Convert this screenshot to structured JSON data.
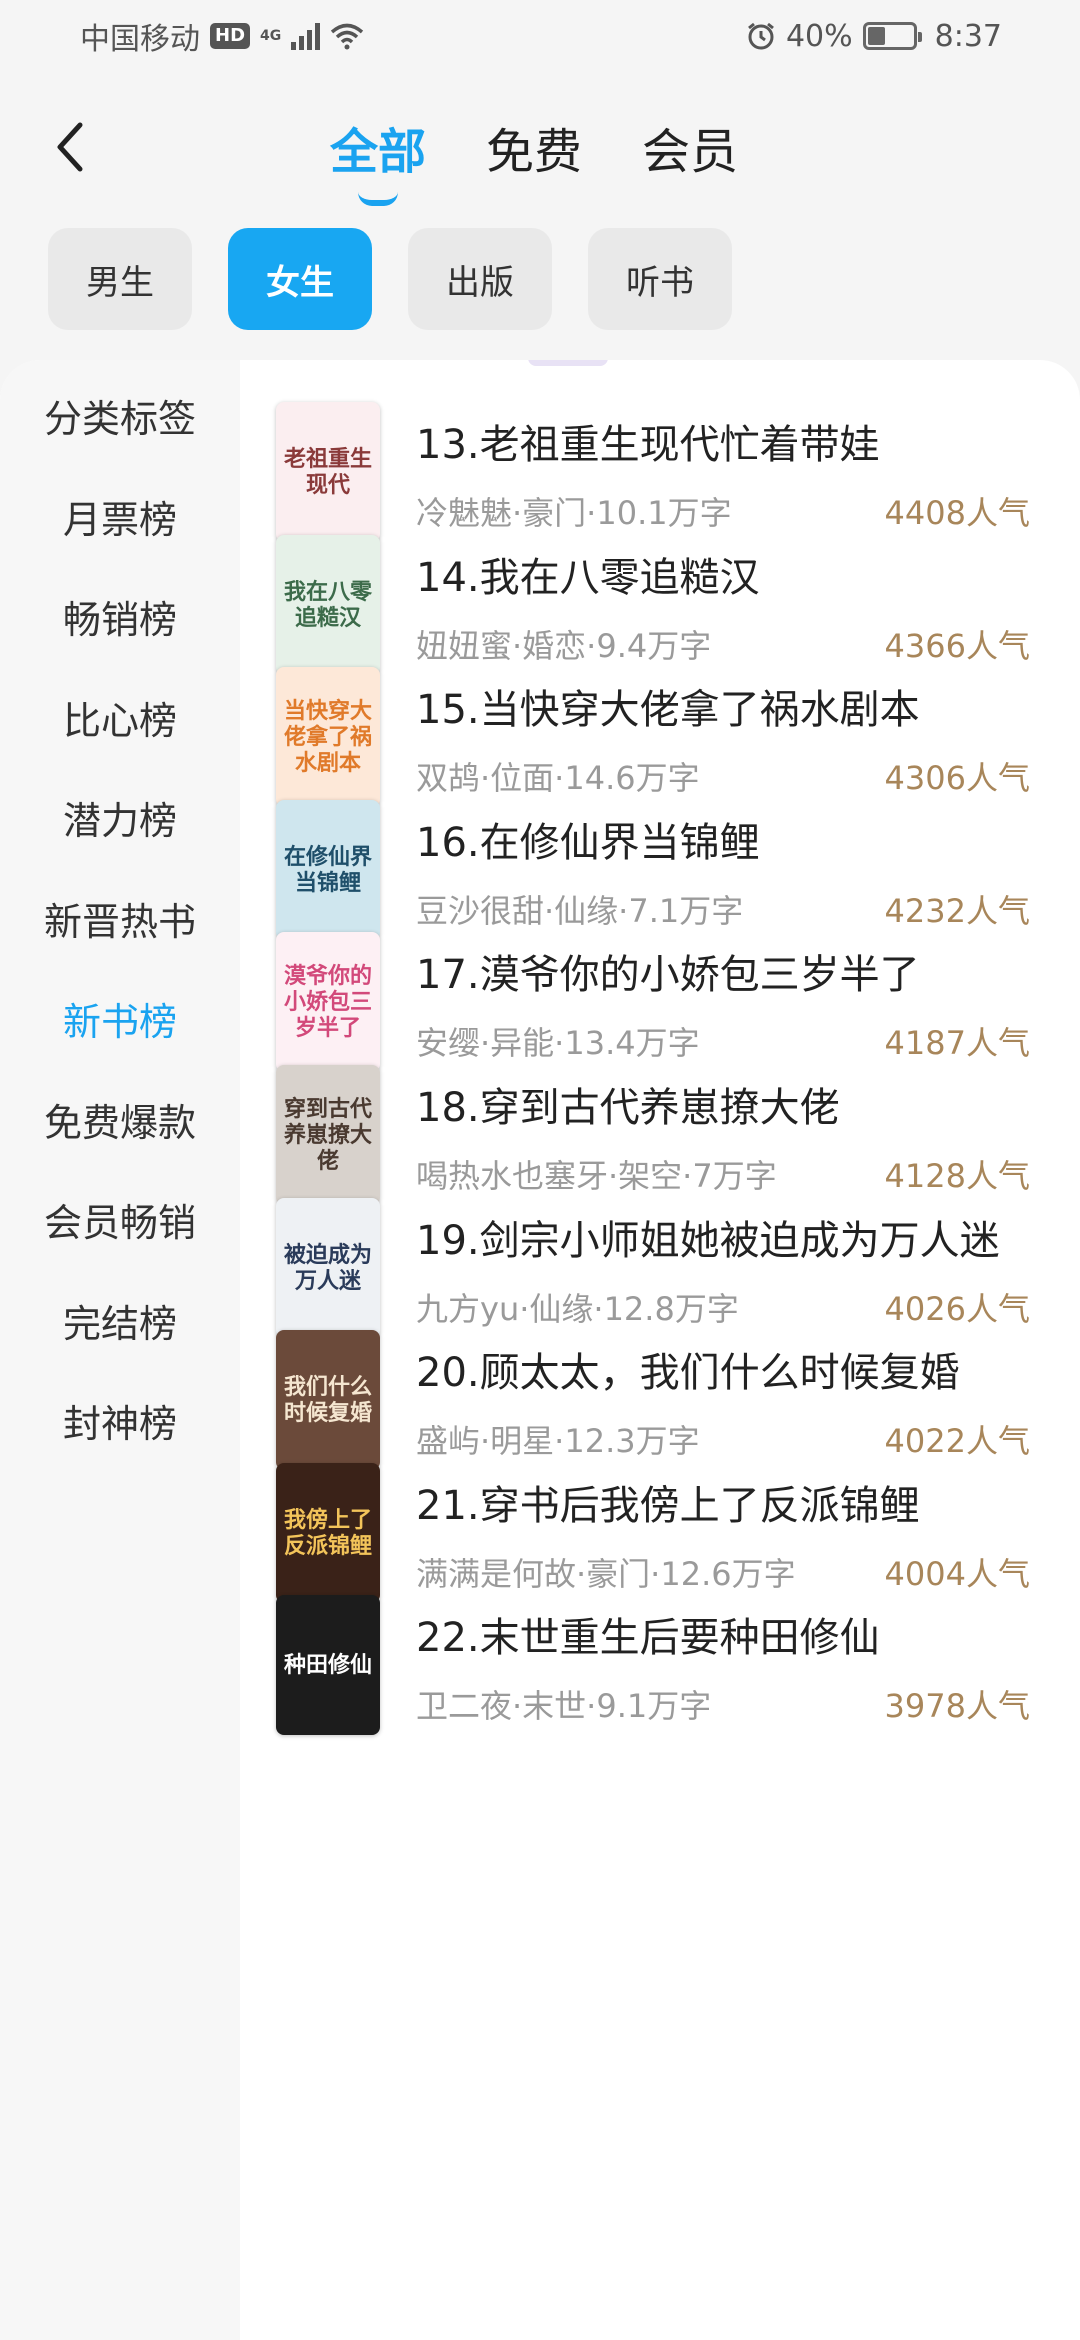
{
  "status": {
    "carrier": "中国移动",
    "hd": "HD",
    "network": "4G",
    "battery": "40%",
    "time": "8:37",
    "battery_level": 0.4
  },
  "nav": {
    "tabs": [
      {
        "label": "全部",
        "active": true
      },
      {
        "label": "免费",
        "active": false
      },
      {
        "label": "会员",
        "active": false
      }
    ]
  },
  "chips": [
    {
      "label": "男生",
      "active": false
    },
    {
      "label": "女生",
      "active": true
    },
    {
      "label": "出版",
      "active": false
    },
    {
      "label": "听书",
      "active": false
    }
  ],
  "sidebar": {
    "items": [
      {
        "label": "分类标签",
        "active": false
      },
      {
        "label": "月票榜",
        "active": false
      },
      {
        "label": "畅销榜",
        "active": false
      },
      {
        "label": "比心榜",
        "active": false
      },
      {
        "label": "潜力榜",
        "active": false
      },
      {
        "label": "新晋热书",
        "active": false
      },
      {
        "label": "新书榜",
        "active": true
      },
      {
        "label": "免费爆款",
        "active": false
      },
      {
        "label": "会员畅销",
        "active": false
      },
      {
        "label": "完结榜",
        "active": false
      },
      {
        "label": "封神榜",
        "active": false
      }
    ]
  },
  "books": [
    {
      "title": "13.老祖重生现代忙着带娃",
      "meta": "冷魅魅·豪门·10.1万字",
      "popularity": "4408人气",
      "cover_text": "老祖重生现代",
      "cover_bg": "#fbeef0",
      "cover_fg": "#8a3a3a"
    },
    {
      "title": "14.我在八零追糙汉",
      "meta": "妞妞蜜·婚恋·9.4万字",
      "popularity": "4366人气",
      "cover_text": "我在八零追糙汉",
      "cover_bg": "#e6f1e8",
      "cover_fg": "#3c6b4a"
    },
    {
      "title": "15.当快穿大佬拿了祸水剧本",
      "meta": "双鸪·位面·14.6万字",
      "popularity": "4306人气",
      "cover_text": "当快穿大佬拿了祸水剧本",
      "cover_bg": "#fde8d8",
      "cover_fg": "#e07a2a"
    },
    {
      "title": "16.在修仙界当锦鲤",
      "meta": "豆沙很甜·仙缘·7.1万字",
      "popularity": "4232人气",
      "cover_text": "在修仙界当锦鲤",
      "cover_bg": "#cfe6ee",
      "cover_fg": "#1f4f6a"
    },
    {
      "title": "17.漠爷你的小娇包三岁半了",
      "meta": "安缨·异能·13.4万字",
      "popularity": "4187人气",
      "cover_text": "漠爷你的小娇包三岁半了",
      "cover_bg": "#fdf0f4",
      "cover_fg": "#d2497a"
    },
    {
      "title": "18.穿到古代养崽撩大佬",
      "meta": "喝热水也塞牙·架空·7万字",
      "popularity": "4128人气",
      "cover_text": "穿到古代养崽撩大佬",
      "cover_bg": "#d8d2cc",
      "cover_fg": "#4a3a30"
    },
    {
      "title": "19.剑宗小师姐她被迫成为万人迷",
      "meta": "九方yu·仙缘·12.8万字",
      "popularity": "4026人气",
      "cover_text": "被迫成为万人迷",
      "cover_bg": "#eef1f4",
      "cover_fg": "#2a3b5a"
    },
    {
      "title": "20.顾太太，我们什么时候复婚",
      "meta": "盛屿·明星·12.3万字",
      "popularity": "4022人气",
      "cover_text": "我们什么时候复婚",
      "cover_bg": "#6b4a3a",
      "cover_fg": "#f5e6d0"
    },
    {
      "title": "21.穿书后我傍上了反派锦鲤",
      "meta": "满满是何故·豪门·12.6万字",
      "popularity": "4004人气",
      "cover_text": "我傍上了反派锦鲤",
      "cover_bg": "#3a2218",
      "cover_fg": "#f3c45a"
    },
    {
      "title": "22.末世重生后要种田修仙",
      "meta": "卫二夜·末世·9.1万字",
      "popularity": "3978人气",
      "cover_text": "种田修仙",
      "cover_bg": "#1c1c1c",
      "cover_fg": "#ffffff"
    }
  ],
  "colors": {
    "accent": "#1aa3f0",
    "popularity": "#a8865a",
    "meta": "#9a9a9a"
  }
}
